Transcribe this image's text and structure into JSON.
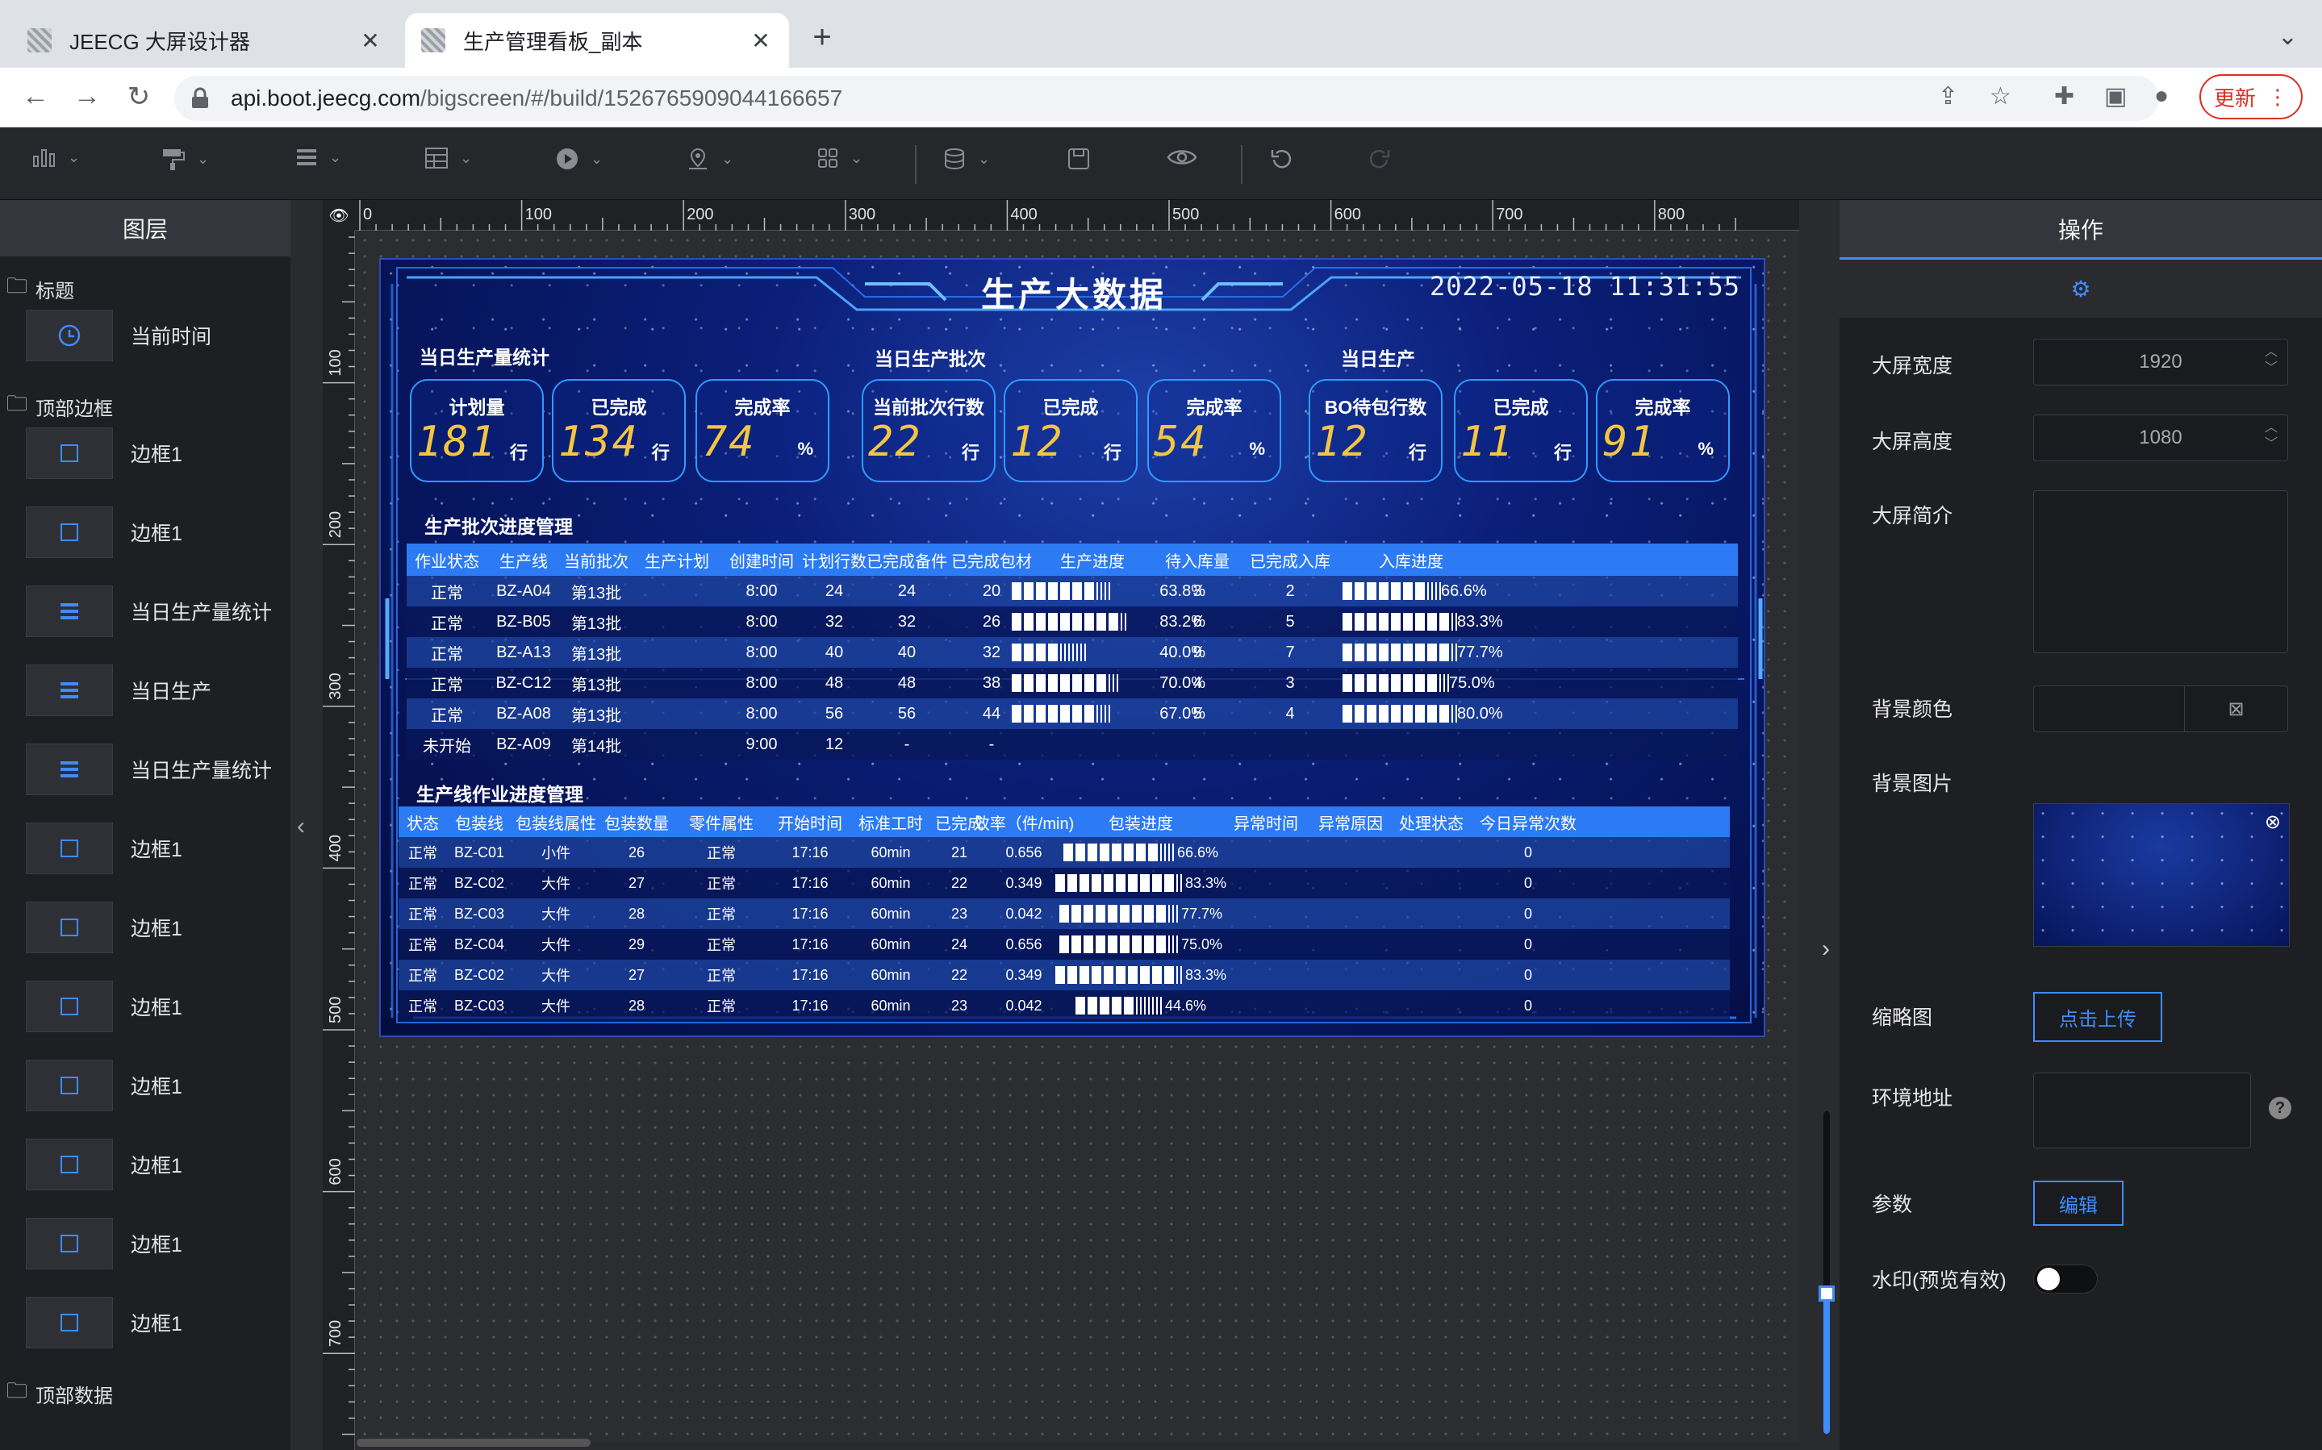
{
  "browser": {
    "tabs": [
      {
        "title": "JEECG 大屏设计器",
        "close": "✕"
      },
      {
        "title": "生产管理看板_副本",
        "close": "✕"
      }
    ],
    "new_tab": "+",
    "tab_menu": "⌄",
    "url_host": "api.boot.jeecg.com",
    "url_path": "/bigscreen/#/build/1526765909044166657",
    "update_label": "更新",
    "menu_dots": "⋮"
  },
  "toolbar": {
    "icons": [
      "bar-chart-icon",
      "paint-roller-icon",
      "list-icon",
      "table-icon",
      "media-icon",
      "map-pin-icon",
      "grid-icon",
      "database-icon",
      "save-icon",
      "preview-eye-icon",
      "undo-icon",
      "redo-icon"
    ]
  },
  "layers": {
    "title": "图层",
    "groups": [
      {
        "label": "标题",
        "items": [
          {
            "label": "当前时间",
            "icon": "clock-icon"
          }
        ]
      },
      {
        "label": "顶部边框",
        "items": [
          {
            "label": "边框1",
            "icon": "square-icon"
          },
          {
            "label": "边框1",
            "icon": "square-icon"
          },
          {
            "label": "当日生产量统计",
            "icon": "list-icon"
          },
          {
            "label": "当日生产",
            "icon": "list-icon"
          },
          {
            "label": "当日生产量统计",
            "icon": "list-icon"
          },
          {
            "label": "边框1",
            "icon": "square-icon"
          },
          {
            "label": "边框1",
            "icon": "square-icon"
          },
          {
            "label": "边框1",
            "icon": "square-icon"
          },
          {
            "label": "边框1",
            "icon": "square-icon"
          },
          {
            "label": "边框1",
            "icon": "square-icon"
          },
          {
            "label": "边框1",
            "icon": "square-icon"
          },
          {
            "label": "边框1",
            "icon": "square-icon"
          }
        ]
      },
      {
        "label": "顶部数据",
        "items": []
      }
    ]
  },
  "ruler": {
    "top": [
      "0",
      "100",
      "200",
      "300",
      "400",
      "500",
      "600",
      "700",
      "800"
    ],
    "left": [
      "100",
      "200",
      "300",
      "400",
      "500",
      "600",
      "700"
    ]
  },
  "screen": {
    "title": "生产大数据",
    "time": "2022-05-18 11:31:55",
    "sections": [
      "当日生产量统计",
      "当日生产批次",
      "当日生产"
    ],
    "cards": [
      {
        "label": "计划量",
        "value": "181",
        "unit": "行"
      },
      {
        "label": "已完成",
        "value": "134",
        "unit": "行"
      },
      {
        "label": "完成率",
        "value": "74",
        "unit": "%"
      },
      {
        "label": "当前批次行数",
        "value": "22",
        "unit": "行"
      },
      {
        "label": "已完成",
        "value": "12",
        "unit": "行"
      },
      {
        "label": "完成率",
        "value": "54",
        "unit": "%"
      },
      {
        "label": "BO待包行数",
        "value": "12",
        "unit": "行"
      },
      {
        "label": "已完成",
        "value": "11",
        "unit": "行"
      },
      {
        "label": "完成率",
        "value": "91",
        "unit": "%"
      }
    ],
    "batch": {
      "title": "生产批次进度管理",
      "headers": [
        "作业状态",
        "生产线",
        "当前批次",
        "生产计划",
        "创建时间",
        "计划行数",
        "已完成备件",
        "已完成包材",
        "生产进度",
        "待入库量",
        "已完成入库",
        "入库进度"
      ],
      "rows": [
        {
          "status": "正常",
          "line": "BZ-A04",
          "batch": "第13批",
          "plan": "",
          "time": "8:00",
          "rows": "24",
          "done": "24",
          "pack": "20",
          "progress": 63.8,
          "progress_text": "63.8%",
          "pending": "3",
          "stored": "2",
          "store_progress": 66.6,
          "store_text": "66.6%"
        },
        {
          "status": "正常",
          "line": "BZ-B05",
          "batch": "第13批",
          "plan": "",
          "time": "8:00",
          "rows": "32",
          "done": "32",
          "pack": "26",
          "progress": 83.2,
          "progress_text": "83.2%",
          "pending": "6",
          "stored": "5",
          "store_progress": 83.3,
          "store_text": "83.3%"
        },
        {
          "status": "正常",
          "line": "BZ-A13",
          "batch": "第13批",
          "plan": "",
          "time": "8:00",
          "rows": "40",
          "done": "40",
          "pack": "32",
          "progress": 40.0,
          "progress_text": "40.0%",
          "pending": "9",
          "stored": "7",
          "store_progress": 77.7,
          "store_text": "77.7%"
        },
        {
          "status": "正常",
          "line": "BZ-C12",
          "batch": "第13批",
          "plan": "",
          "time": "8:00",
          "rows": "48",
          "done": "48",
          "pack": "38",
          "progress": 70.0,
          "progress_text": "70.0%",
          "pending": "4",
          "stored": "3",
          "store_progress": 75.0,
          "store_text": "75.0%"
        },
        {
          "status": "正常",
          "line": "BZ-A08",
          "batch": "第13批",
          "plan": "",
          "time": "8:00",
          "rows": "56",
          "done": "56",
          "pack": "44",
          "progress": 67.0,
          "progress_text": "67.0%",
          "pending": "5",
          "stored": "4",
          "store_progress": 80.0,
          "store_text": "80.0%"
        },
        {
          "status": "未开始",
          "line": "BZ-A09",
          "batch": "第14批",
          "plan": "",
          "time": "9:00",
          "rows": "12",
          "done": "-",
          "pack": "-",
          "progress": null,
          "progress_text": "",
          "pending": "",
          "stored": "",
          "store_progress": null,
          "store_text": ""
        }
      ]
    },
    "line": {
      "title": "生产线作业进度管理",
      "headers": [
        "状态",
        "包装线",
        "包装线属性",
        "包装数量",
        "零件属性",
        "开始时间",
        "标准工时",
        "已完成",
        "效率（件/min)",
        "包装进度",
        "异常时间",
        "异常原因",
        "处理状态",
        "今日异常次数"
      ],
      "rows": [
        {
          "status": "正常",
          "line": "BZ-C01",
          "attr": "小件",
          "qty": "26",
          "part": "正常",
          "start": "17:16",
          "std": "60min",
          "done": "21",
          "eff": "0.656",
          "progress": 66.6,
          "progress_text": "66.6%",
          "count": "0"
        },
        {
          "status": "正常",
          "line": "BZ-C02",
          "attr": "大件",
          "qty": "27",
          "part": "正常",
          "start": "17:16",
          "std": "60min",
          "done": "22",
          "eff": "0.349",
          "progress": 83.3,
          "progress_text": "83.3%",
          "count": "0"
        },
        {
          "status": "正常",
          "line": "BZ-C03",
          "attr": "大件",
          "qty": "28",
          "part": "正常",
          "start": "17:16",
          "std": "60min",
          "done": "23",
          "eff": "0.042",
          "progress": 77.7,
          "progress_text": "77.7%",
          "count": "0"
        },
        {
          "status": "正常",
          "line": "BZ-C04",
          "attr": "大件",
          "qty": "29",
          "part": "正常",
          "start": "17:16",
          "std": "60min",
          "done": "24",
          "eff": "0.656",
          "progress": 75.0,
          "progress_text": "75.0%",
          "count": "0"
        },
        {
          "status": "正常",
          "line": "BZ-C02",
          "attr": "大件",
          "qty": "27",
          "part": "正常",
          "start": "17:16",
          "std": "60min",
          "done": "22",
          "eff": "0.349",
          "progress": 83.3,
          "progress_text": "83.3%",
          "count": "0"
        },
        {
          "status": "正常",
          "line": "BZ-C03",
          "attr": "大件",
          "qty": "28",
          "part": "正常",
          "start": "17:16",
          "std": "60min",
          "done": "23",
          "eff": "0.042",
          "progress": 44.6,
          "progress_text": "44.6%",
          "count": "0"
        }
      ]
    }
  },
  "props": {
    "title": "操作",
    "width_label": "大屏宽度",
    "width": "1920",
    "height_label": "大屏高度",
    "height": "1080",
    "desc_label": "大屏简介",
    "bgcolor_label": "背景颜色",
    "bgimg_label": "背景图片",
    "thumb_label": "缩略图",
    "upload": "点击上传",
    "env_label": "环境地址",
    "param_label": "参数",
    "edit": "编辑",
    "watermark_label": "水印(预览有效)",
    "watermark_on": false,
    "accent": "#3f8cff"
  }
}
